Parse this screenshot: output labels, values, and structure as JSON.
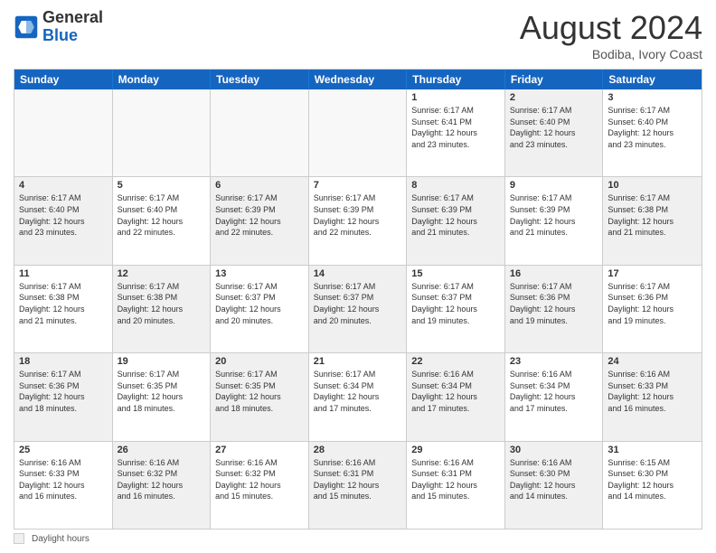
{
  "header": {
    "logo_general": "General",
    "logo_blue": "Blue",
    "month_year": "August 2024",
    "location": "Bodiba, Ivory Coast"
  },
  "days_of_week": [
    "Sunday",
    "Monday",
    "Tuesday",
    "Wednesday",
    "Thursday",
    "Friday",
    "Saturday"
  ],
  "weeks": [
    [
      {
        "day": "",
        "text": "",
        "empty": true
      },
      {
        "day": "",
        "text": "",
        "empty": true
      },
      {
        "day": "",
        "text": "",
        "empty": true
      },
      {
        "day": "",
        "text": "",
        "empty": true
      },
      {
        "day": "1",
        "text": "Sunrise: 6:17 AM\nSunset: 6:41 PM\nDaylight: 12 hours\nand 23 minutes.",
        "shaded": false
      },
      {
        "day": "2",
        "text": "Sunrise: 6:17 AM\nSunset: 6:40 PM\nDaylight: 12 hours\nand 23 minutes.",
        "shaded": true
      },
      {
        "day": "3",
        "text": "Sunrise: 6:17 AM\nSunset: 6:40 PM\nDaylight: 12 hours\nand 23 minutes.",
        "shaded": false
      }
    ],
    [
      {
        "day": "4",
        "text": "Sunrise: 6:17 AM\nSunset: 6:40 PM\nDaylight: 12 hours\nand 23 minutes.",
        "shaded": true
      },
      {
        "day": "5",
        "text": "Sunrise: 6:17 AM\nSunset: 6:40 PM\nDaylight: 12 hours\nand 22 minutes.",
        "shaded": false
      },
      {
        "day": "6",
        "text": "Sunrise: 6:17 AM\nSunset: 6:39 PM\nDaylight: 12 hours\nand 22 minutes.",
        "shaded": true
      },
      {
        "day": "7",
        "text": "Sunrise: 6:17 AM\nSunset: 6:39 PM\nDaylight: 12 hours\nand 22 minutes.",
        "shaded": false
      },
      {
        "day": "8",
        "text": "Sunrise: 6:17 AM\nSunset: 6:39 PM\nDaylight: 12 hours\nand 21 minutes.",
        "shaded": true
      },
      {
        "day": "9",
        "text": "Sunrise: 6:17 AM\nSunset: 6:39 PM\nDaylight: 12 hours\nand 21 minutes.",
        "shaded": false
      },
      {
        "day": "10",
        "text": "Sunrise: 6:17 AM\nSunset: 6:38 PM\nDaylight: 12 hours\nand 21 minutes.",
        "shaded": true
      }
    ],
    [
      {
        "day": "11",
        "text": "Sunrise: 6:17 AM\nSunset: 6:38 PM\nDaylight: 12 hours\nand 21 minutes.",
        "shaded": false
      },
      {
        "day": "12",
        "text": "Sunrise: 6:17 AM\nSunset: 6:38 PM\nDaylight: 12 hours\nand 20 minutes.",
        "shaded": true
      },
      {
        "day": "13",
        "text": "Sunrise: 6:17 AM\nSunset: 6:37 PM\nDaylight: 12 hours\nand 20 minutes.",
        "shaded": false
      },
      {
        "day": "14",
        "text": "Sunrise: 6:17 AM\nSunset: 6:37 PM\nDaylight: 12 hours\nand 20 minutes.",
        "shaded": true
      },
      {
        "day": "15",
        "text": "Sunrise: 6:17 AM\nSunset: 6:37 PM\nDaylight: 12 hours\nand 19 minutes.",
        "shaded": false
      },
      {
        "day": "16",
        "text": "Sunrise: 6:17 AM\nSunset: 6:36 PM\nDaylight: 12 hours\nand 19 minutes.",
        "shaded": true
      },
      {
        "day": "17",
        "text": "Sunrise: 6:17 AM\nSunset: 6:36 PM\nDaylight: 12 hours\nand 19 minutes.",
        "shaded": false
      }
    ],
    [
      {
        "day": "18",
        "text": "Sunrise: 6:17 AM\nSunset: 6:36 PM\nDaylight: 12 hours\nand 18 minutes.",
        "shaded": true
      },
      {
        "day": "19",
        "text": "Sunrise: 6:17 AM\nSunset: 6:35 PM\nDaylight: 12 hours\nand 18 minutes.",
        "shaded": false
      },
      {
        "day": "20",
        "text": "Sunrise: 6:17 AM\nSunset: 6:35 PM\nDaylight: 12 hours\nand 18 minutes.",
        "shaded": true
      },
      {
        "day": "21",
        "text": "Sunrise: 6:17 AM\nSunset: 6:34 PM\nDaylight: 12 hours\nand 17 minutes.",
        "shaded": false
      },
      {
        "day": "22",
        "text": "Sunrise: 6:16 AM\nSunset: 6:34 PM\nDaylight: 12 hours\nand 17 minutes.",
        "shaded": true
      },
      {
        "day": "23",
        "text": "Sunrise: 6:16 AM\nSunset: 6:34 PM\nDaylight: 12 hours\nand 17 minutes.",
        "shaded": false
      },
      {
        "day": "24",
        "text": "Sunrise: 6:16 AM\nSunset: 6:33 PM\nDaylight: 12 hours\nand 16 minutes.",
        "shaded": true
      }
    ],
    [
      {
        "day": "25",
        "text": "Sunrise: 6:16 AM\nSunset: 6:33 PM\nDaylight: 12 hours\nand 16 minutes.",
        "shaded": false
      },
      {
        "day": "26",
        "text": "Sunrise: 6:16 AM\nSunset: 6:32 PM\nDaylight: 12 hours\nand 16 minutes.",
        "shaded": true
      },
      {
        "day": "27",
        "text": "Sunrise: 6:16 AM\nSunset: 6:32 PM\nDaylight: 12 hours\nand 15 minutes.",
        "shaded": false
      },
      {
        "day": "28",
        "text": "Sunrise: 6:16 AM\nSunset: 6:31 PM\nDaylight: 12 hours\nand 15 minutes.",
        "shaded": true
      },
      {
        "day": "29",
        "text": "Sunrise: 6:16 AM\nSunset: 6:31 PM\nDaylight: 12 hours\nand 15 minutes.",
        "shaded": false
      },
      {
        "day": "30",
        "text": "Sunrise: 6:16 AM\nSunset: 6:30 PM\nDaylight: 12 hours\nand 14 minutes.",
        "shaded": true
      },
      {
        "day": "31",
        "text": "Sunrise: 6:15 AM\nSunset: 6:30 PM\nDaylight: 12 hours\nand 14 minutes.",
        "shaded": false
      }
    ]
  ],
  "footer": {
    "daylight_label": "Daylight hours"
  }
}
